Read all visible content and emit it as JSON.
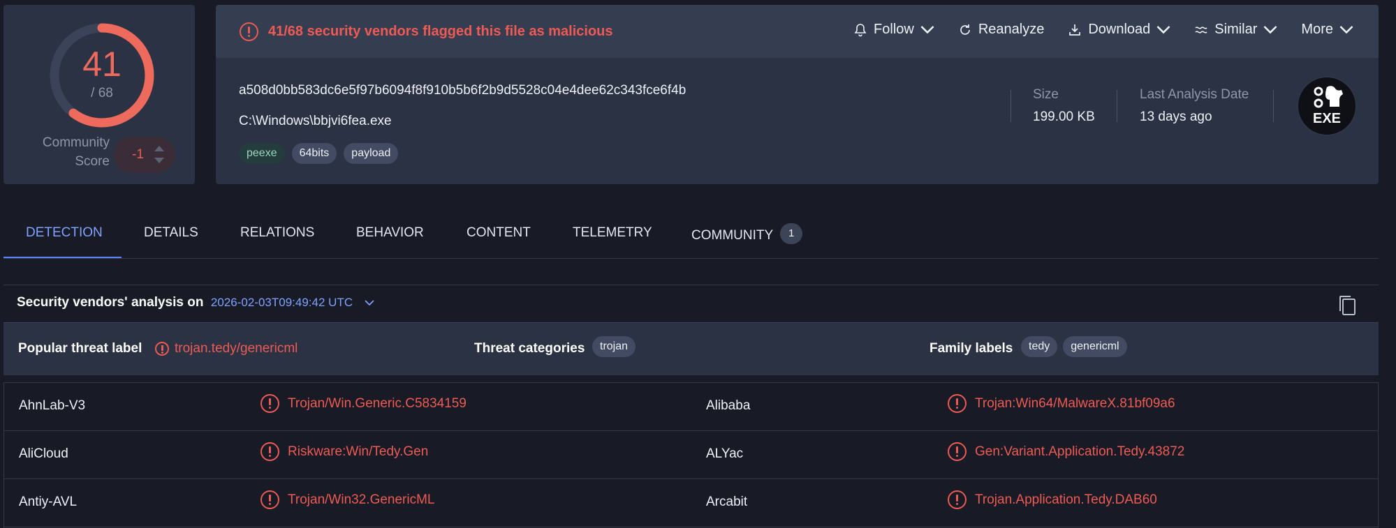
{
  "score": {
    "detections": "41",
    "total": "/ 68",
    "fraction": 0.603,
    "community_label": "Community Score",
    "community_value": "-1"
  },
  "alert": {
    "text": "41/68 security vendors flagged this file as malicious"
  },
  "actions": [
    {
      "label": "Follow",
      "icon": "bell-icon"
    },
    {
      "label": "Reanalyze",
      "icon": "refresh-icon"
    },
    {
      "label": "Download",
      "icon": "download-icon"
    },
    {
      "label": "Similar",
      "icon": "similar-icon"
    },
    {
      "label": "More",
      "icon": "chevron-down-icon"
    }
  ],
  "file": {
    "hash": "a508d0bb583dc6e5f97b6094f8f910b5b6f2b9d5528c04e4dee62c343fce6f4b",
    "name": "C:\\Windows\\bbjvi6fea.exe",
    "tags": [
      "peexe",
      "64bits",
      "payload"
    ],
    "size_label": "Size",
    "size_value": "199.00 KB",
    "date_label": "Last Analysis Date",
    "date_value": "13 days ago",
    "type_badge": "EXE"
  },
  "tabs": [
    "DETECTION",
    "DETAILS",
    "RELATIONS",
    "BEHAVIOR",
    "CONTENT",
    "TELEMETRY",
    "COMMUNITY"
  ],
  "community_count": "1",
  "analysis": {
    "title": "Security vendors' analysis on",
    "date": "2026-02-03T09:49:42 UTC",
    "popular_label": "Popular threat label",
    "popular_value": "trojan.tedy/genericml",
    "categories_label": "Threat categories",
    "categories": [
      "trojan"
    ],
    "family_label": "Family labels",
    "families": [
      "tedy",
      "genericml"
    ]
  },
  "vendors": [
    {
      "left_name": "AhnLab-V3",
      "left_result": "Trojan/Win.Generic.C5834159",
      "right_name": "Alibaba",
      "right_result": "Trojan:Win64/MalwareX.81bf09a6"
    },
    {
      "left_name": "AliCloud",
      "left_result": "Riskware:Win/Tedy.Gen",
      "right_name": "ALYac",
      "right_result": "Gen:Variant.Application.Tedy.43872"
    },
    {
      "left_name": "Antiy-AVL",
      "left_result": "Trojan/Win32.GenericML",
      "right_name": "Arcabit",
      "right_result": "Trojan.Application.Tedy.DAB60"
    }
  ],
  "colors": {
    "malicious": "#ee5a54",
    "accent": "#5b86ff",
    "panel": "#2b3244",
    "background": "#181b25"
  }
}
